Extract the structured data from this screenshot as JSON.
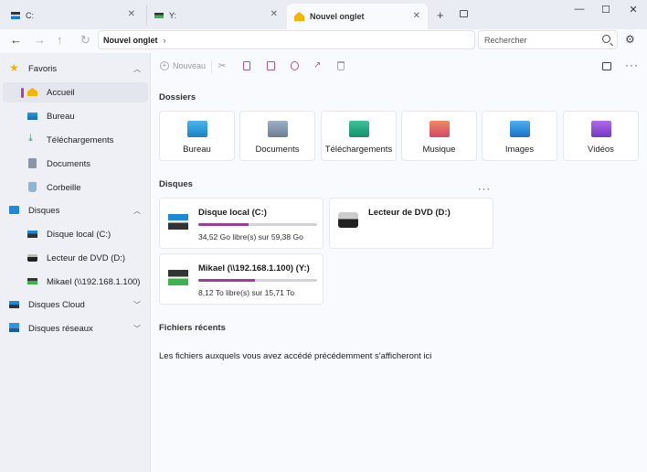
{
  "tabs": [
    {
      "label": "C:",
      "icon": "drive-icon"
    },
    {
      "label": "Y:",
      "icon": "network-drive-icon"
    },
    {
      "label": "Nouvel onglet",
      "icon": "home-icon",
      "active": true
    }
  ],
  "window": {
    "new_tab": "+",
    "minimize": "—",
    "maximize": "☐",
    "close": "✕"
  },
  "address": {
    "path": "Nouvel onglet",
    "search_placeholder": "Rechercher"
  },
  "sidebar": {
    "items": [
      {
        "label": "Favoris",
        "icon": "star-icon",
        "expander": "up"
      },
      {
        "label": "Accueil",
        "icon": "home-icon",
        "active": true
      },
      {
        "label": "Bureau",
        "icon": "desktop-icon"
      },
      {
        "label": "Téléchargements",
        "icon": "download-icon"
      },
      {
        "label": "Documents",
        "icon": "documents-icon"
      },
      {
        "label": "Corbeille",
        "icon": "recycle-bin-icon"
      },
      {
        "label": "Disques",
        "icon": "computer-icon",
        "expander": "up"
      },
      {
        "label": "Disque local (C:)",
        "icon": "drive-icon"
      },
      {
        "label": "Lecteur de DVD (D:)",
        "icon": "dvd-icon"
      },
      {
        "label": "Mikael (\\\\192.168.1.100)",
        "icon": "network-drive-icon"
      },
      {
        "label": "Disques Cloud",
        "icon": "cloud-drive-icon",
        "expander": "down"
      },
      {
        "label": "Disques réseaux",
        "icon": "network-icon",
        "expander": "down"
      }
    ]
  },
  "toolbar": {
    "new_label": "Nouveau"
  },
  "sections": {
    "folders": "Dossiers",
    "drives": "Disques",
    "recent": "Fichiers récents"
  },
  "folders": [
    {
      "label": "Bureau",
      "icon": "desktop-folder-icon",
      "color": "#2a9fd8"
    },
    {
      "label": "Documents",
      "icon": "documents-folder-icon",
      "color": "#7d8fa6"
    },
    {
      "label": "Téléchargements",
      "icon": "downloads-folder-icon",
      "color": "#1ba47a"
    },
    {
      "label": "Musique",
      "icon": "music-folder-icon",
      "color": "#e0664a"
    },
    {
      "label": "Images",
      "icon": "pictures-folder-icon",
      "color": "#2c8fd6"
    },
    {
      "label": "Vidéos",
      "icon": "videos-folder-icon",
      "color": "#8a4bd3"
    }
  ],
  "drives": [
    {
      "name": "Disque local (C:)",
      "free": "34,52 Go libre(s) sur 59,38 Go",
      "used_fraction": 0.42
    },
    {
      "name": "Lecteur de DVD (D:)"
    },
    {
      "name": "Mikael (\\\\192.168.1.100) (Y:)",
      "free": "8,12 To libre(s) sur 15,71 To",
      "used_fraction": 0.48
    }
  ],
  "recent": {
    "empty_message": "Les fichiers auxquels vous avez accédé précédemment s'afficheront ici"
  },
  "colors": {
    "accent": "#9b3c9f",
    "progress_track": "#d2d4da"
  }
}
